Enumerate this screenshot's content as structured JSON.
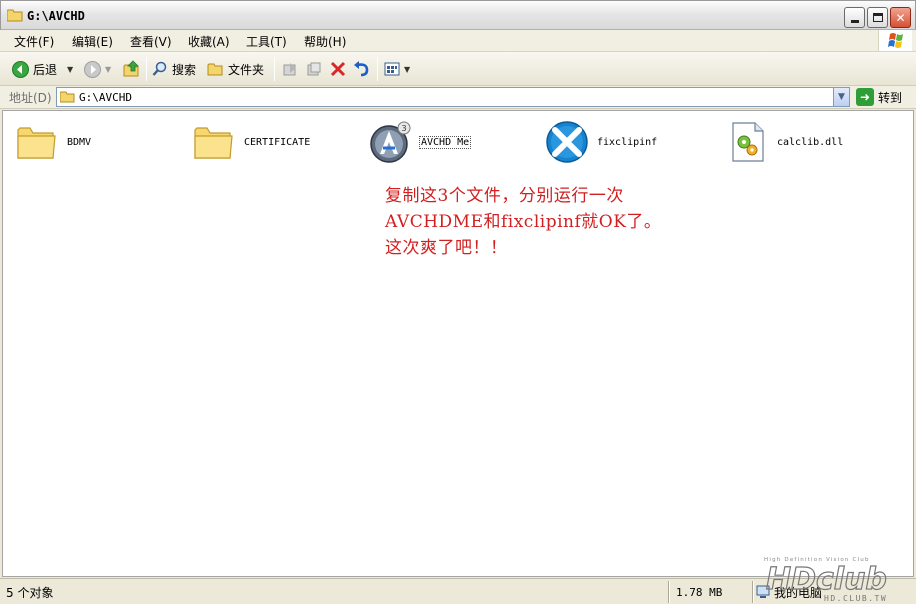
{
  "window": {
    "title": "G:\\AVCHD"
  },
  "menubar": {
    "items": [
      "文件(F)",
      "编辑(E)",
      "查看(V)",
      "收藏(A)",
      "工具(T)",
      "帮助(H)"
    ]
  },
  "toolbar": {
    "back_label": "后退",
    "search_label": "搜索",
    "folders_label": "文件夹"
  },
  "addressbar": {
    "label": "地址(D)",
    "value": "G:\\AVCHD",
    "go_label": "转到"
  },
  "files": [
    {
      "name": "BDMV",
      "icon": "folder-icon"
    },
    {
      "name": "CERTIFICATE",
      "icon": "folder-icon"
    },
    {
      "name": "AVCHD Me",
      "icon": "avchd-me-app-icon"
    },
    {
      "name": "fixclipinf",
      "icon": "fixclipinf-app-icon"
    },
    {
      "name": "calclib.dll",
      "icon": "dll-file-icon"
    }
  ],
  "note": {
    "lines": [
      "复制这3个文件，分别运行一次",
      "AVCHDME和fixclipinf就OK了。",
      "这次爽了吧！！"
    ]
  },
  "statusbar": {
    "object_count": "5 个对象",
    "size": "1.78 MB",
    "location": "我的电脑"
  },
  "watermark": {
    "tagline": "High Definition Vision Club",
    "logo": "HDclub",
    "url": "HD.CLUB.TW"
  },
  "colors": {
    "note_text": "#d21f1f",
    "window_bg": "#ece9d8",
    "address_border": "#7f9db9",
    "go_button": "#2f9e36"
  }
}
